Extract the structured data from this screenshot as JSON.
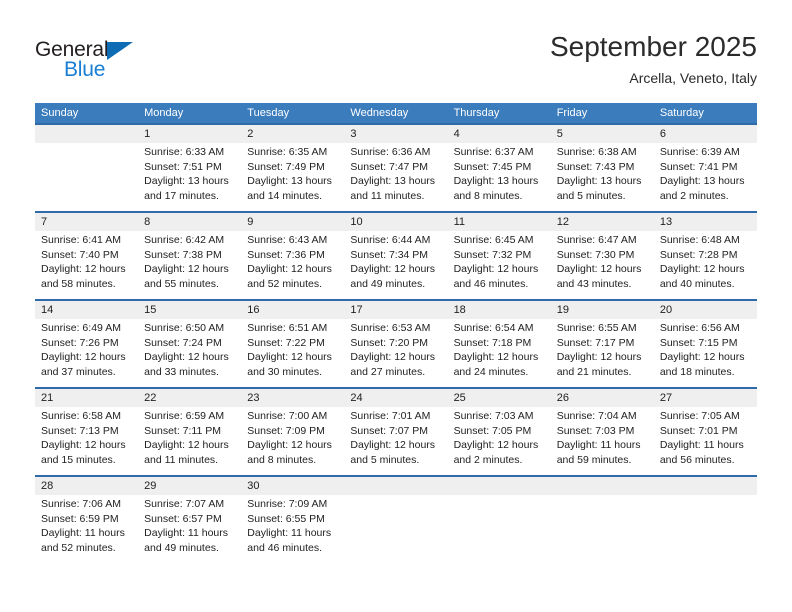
{
  "brand": {
    "name_top": "General",
    "name_bottom": "Blue",
    "triangle_color": "#0d6cb4",
    "blue_text_color": "#1a7fd4",
    "top_text_color": "#231f20"
  },
  "header": {
    "title": "September 2025",
    "location": "Arcella, Veneto, Italy"
  },
  "theme": {
    "header_row_bg": "#3b7cbd",
    "week_top_border": "#2f6aa8",
    "day_number_band_bg": "#efefef",
    "text_color": "#222222"
  },
  "calendar": {
    "weekday_headers": [
      "Sunday",
      "Monday",
      "Tuesday",
      "Wednesday",
      "Thursday",
      "Friday",
      "Saturday"
    ],
    "weeks": [
      {
        "days": [
          {
            "number": "",
            "sunrise": "",
            "sunset": "",
            "daylight_line1": "",
            "daylight_line2": ""
          },
          {
            "number": "1",
            "sunrise": "Sunrise: 6:33 AM",
            "sunset": "Sunset: 7:51 PM",
            "daylight_line1": "Daylight: 13 hours",
            "daylight_line2": "and 17 minutes."
          },
          {
            "number": "2",
            "sunrise": "Sunrise: 6:35 AM",
            "sunset": "Sunset: 7:49 PM",
            "daylight_line1": "Daylight: 13 hours",
            "daylight_line2": "and 14 minutes."
          },
          {
            "number": "3",
            "sunrise": "Sunrise: 6:36 AM",
            "sunset": "Sunset: 7:47 PM",
            "daylight_line1": "Daylight: 13 hours",
            "daylight_line2": "and 11 minutes."
          },
          {
            "number": "4",
            "sunrise": "Sunrise: 6:37 AM",
            "sunset": "Sunset: 7:45 PM",
            "daylight_line1": "Daylight: 13 hours",
            "daylight_line2": "and 8 minutes."
          },
          {
            "number": "5",
            "sunrise": "Sunrise: 6:38 AM",
            "sunset": "Sunset: 7:43 PM",
            "daylight_line1": "Daylight: 13 hours",
            "daylight_line2": "and 5 minutes."
          },
          {
            "number": "6",
            "sunrise": "Sunrise: 6:39 AM",
            "sunset": "Sunset: 7:41 PM",
            "daylight_line1": "Daylight: 13 hours",
            "daylight_line2": "and 2 minutes."
          }
        ]
      },
      {
        "days": [
          {
            "number": "7",
            "sunrise": "Sunrise: 6:41 AM",
            "sunset": "Sunset: 7:40 PM",
            "daylight_line1": "Daylight: 12 hours",
            "daylight_line2": "and 58 minutes."
          },
          {
            "number": "8",
            "sunrise": "Sunrise: 6:42 AM",
            "sunset": "Sunset: 7:38 PM",
            "daylight_line1": "Daylight: 12 hours",
            "daylight_line2": "and 55 minutes."
          },
          {
            "number": "9",
            "sunrise": "Sunrise: 6:43 AM",
            "sunset": "Sunset: 7:36 PM",
            "daylight_line1": "Daylight: 12 hours",
            "daylight_line2": "and 52 minutes."
          },
          {
            "number": "10",
            "sunrise": "Sunrise: 6:44 AM",
            "sunset": "Sunset: 7:34 PM",
            "daylight_line1": "Daylight: 12 hours",
            "daylight_line2": "and 49 minutes."
          },
          {
            "number": "11",
            "sunrise": "Sunrise: 6:45 AM",
            "sunset": "Sunset: 7:32 PM",
            "daylight_line1": "Daylight: 12 hours",
            "daylight_line2": "and 46 minutes."
          },
          {
            "number": "12",
            "sunrise": "Sunrise: 6:47 AM",
            "sunset": "Sunset: 7:30 PM",
            "daylight_line1": "Daylight: 12 hours",
            "daylight_line2": "and 43 minutes."
          },
          {
            "number": "13",
            "sunrise": "Sunrise: 6:48 AM",
            "sunset": "Sunset: 7:28 PM",
            "daylight_line1": "Daylight: 12 hours",
            "daylight_line2": "and 40 minutes."
          }
        ]
      },
      {
        "days": [
          {
            "number": "14",
            "sunrise": "Sunrise: 6:49 AM",
            "sunset": "Sunset: 7:26 PM",
            "daylight_line1": "Daylight: 12 hours",
            "daylight_line2": "and 37 minutes."
          },
          {
            "number": "15",
            "sunrise": "Sunrise: 6:50 AM",
            "sunset": "Sunset: 7:24 PM",
            "daylight_line1": "Daylight: 12 hours",
            "daylight_line2": "and 33 minutes."
          },
          {
            "number": "16",
            "sunrise": "Sunrise: 6:51 AM",
            "sunset": "Sunset: 7:22 PM",
            "daylight_line1": "Daylight: 12 hours",
            "daylight_line2": "and 30 minutes."
          },
          {
            "number": "17",
            "sunrise": "Sunrise: 6:53 AM",
            "sunset": "Sunset: 7:20 PM",
            "daylight_line1": "Daylight: 12 hours",
            "daylight_line2": "and 27 minutes."
          },
          {
            "number": "18",
            "sunrise": "Sunrise: 6:54 AM",
            "sunset": "Sunset: 7:18 PM",
            "daylight_line1": "Daylight: 12 hours",
            "daylight_line2": "and 24 minutes."
          },
          {
            "number": "19",
            "sunrise": "Sunrise: 6:55 AM",
            "sunset": "Sunset: 7:17 PM",
            "daylight_line1": "Daylight: 12 hours",
            "daylight_line2": "and 21 minutes."
          },
          {
            "number": "20",
            "sunrise": "Sunrise: 6:56 AM",
            "sunset": "Sunset: 7:15 PM",
            "daylight_line1": "Daylight: 12 hours",
            "daylight_line2": "and 18 minutes."
          }
        ]
      },
      {
        "days": [
          {
            "number": "21",
            "sunrise": "Sunrise: 6:58 AM",
            "sunset": "Sunset: 7:13 PM",
            "daylight_line1": "Daylight: 12 hours",
            "daylight_line2": "and 15 minutes."
          },
          {
            "number": "22",
            "sunrise": "Sunrise: 6:59 AM",
            "sunset": "Sunset: 7:11 PM",
            "daylight_line1": "Daylight: 12 hours",
            "daylight_line2": "and 11 minutes."
          },
          {
            "number": "23",
            "sunrise": "Sunrise: 7:00 AM",
            "sunset": "Sunset: 7:09 PM",
            "daylight_line1": "Daylight: 12 hours",
            "daylight_line2": "and 8 minutes."
          },
          {
            "number": "24",
            "sunrise": "Sunrise: 7:01 AM",
            "sunset": "Sunset: 7:07 PM",
            "daylight_line1": "Daylight: 12 hours",
            "daylight_line2": "and 5 minutes."
          },
          {
            "number": "25",
            "sunrise": "Sunrise: 7:03 AM",
            "sunset": "Sunset: 7:05 PM",
            "daylight_line1": "Daylight: 12 hours",
            "daylight_line2": "and 2 minutes."
          },
          {
            "number": "26",
            "sunrise": "Sunrise: 7:04 AM",
            "sunset": "Sunset: 7:03 PM",
            "daylight_line1": "Daylight: 11 hours",
            "daylight_line2": "and 59 minutes."
          },
          {
            "number": "27",
            "sunrise": "Sunrise: 7:05 AM",
            "sunset": "Sunset: 7:01 PM",
            "daylight_line1": "Daylight: 11 hours",
            "daylight_line2": "and 56 minutes."
          }
        ]
      },
      {
        "days": [
          {
            "number": "28",
            "sunrise": "Sunrise: 7:06 AM",
            "sunset": "Sunset: 6:59 PM",
            "daylight_line1": "Daylight: 11 hours",
            "daylight_line2": "and 52 minutes."
          },
          {
            "number": "29",
            "sunrise": "Sunrise: 7:07 AM",
            "sunset": "Sunset: 6:57 PM",
            "daylight_line1": "Daylight: 11 hours",
            "daylight_line2": "and 49 minutes."
          },
          {
            "number": "30",
            "sunrise": "Sunrise: 7:09 AM",
            "sunset": "Sunset: 6:55 PM",
            "daylight_line1": "Daylight: 11 hours",
            "daylight_line2": "and 46 minutes."
          },
          {
            "number": "",
            "sunrise": "",
            "sunset": "",
            "daylight_line1": "",
            "daylight_line2": ""
          },
          {
            "number": "",
            "sunrise": "",
            "sunset": "",
            "daylight_line1": "",
            "daylight_line2": ""
          },
          {
            "number": "",
            "sunrise": "",
            "sunset": "",
            "daylight_line1": "",
            "daylight_line2": ""
          },
          {
            "number": "",
            "sunrise": "",
            "sunset": "",
            "daylight_line1": "",
            "daylight_line2": ""
          }
        ]
      }
    ]
  }
}
